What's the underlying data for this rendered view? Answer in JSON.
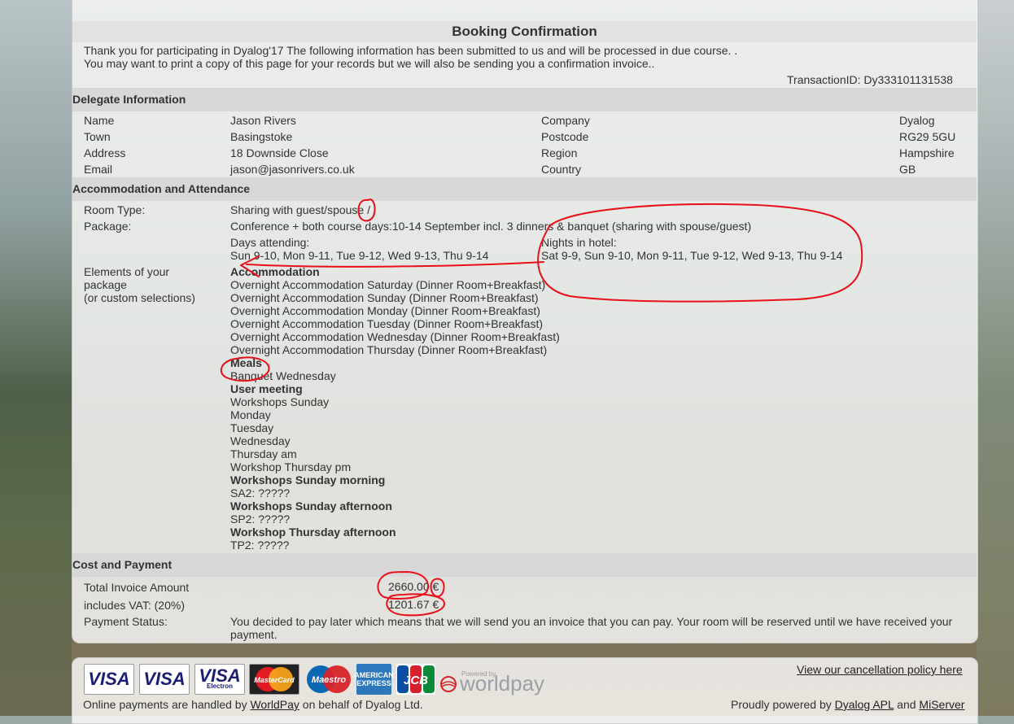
{
  "page": {
    "title": "Booking Confirmation",
    "intro_line1": "Thank you for participating in Dyalog'17 The following information has been submitted to us and will be processed in due course. .",
    "intro_line2": "You may want to print a copy of this page for your records but we will also be sending you a confirmation invoice..",
    "transaction_id": "TransactionID: Dy333101131538"
  },
  "delegate": {
    "header": "Delegate Information",
    "name_label": "Name",
    "name_value": "Jason Rivers",
    "company_label": "Company",
    "company_value": "Dyalog",
    "town_label": "Town",
    "town_value": "Basingstoke",
    "postcode_label": "Postcode",
    "postcode_value": "RG29 5GU",
    "address_label": "Address",
    "address_value": "18 Downside Close",
    "region_label": "Region",
    "region_value": "Hampshire",
    "email_label": "Email",
    "email_value": "jason@jasonrivers.co.uk",
    "country_label": "Country",
    "country_value": "GB"
  },
  "accommodation": {
    "header": "Accommodation and Attendance",
    "room_type_label": "Room Type:",
    "room_type_value": "Sharing with guest/spouse /",
    "package_label": "Package:",
    "package_value": "Conference + both course days:10-14 September incl. 3 dinners & banquet (sharing with spouse/guest)",
    "days_attending_label": "Days attending:",
    "days_attending_value": "Sun 9-10, Mon 9-11, Tue 9-12, Wed 9-13, Thu 9-14",
    "nights_label": "Nights in hotel:",
    "nights_value": "Sat 9-9, Sun 9-10, Mon 9-11, Tue 9-12, Wed 9-13, Thu 9-14",
    "elements_label_1": "Elements of your",
    "elements_label_2": "package",
    "elements_label_3": "(or custom selections)",
    "elements": [
      {
        "text": "Accommodation",
        "bold": true
      },
      {
        "text": "Overnight Accommodation Saturday (Dinner Room+Breakfast)",
        "bold": false
      },
      {
        "text": "Overnight Accommodation Sunday (Dinner Room+Breakfast)",
        "bold": false
      },
      {
        "text": "Overnight Accommodation Monday (Dinner Room+Breakfast)",
        "bold": false
      },
      {
        "text": "Overnight Accommodation Tuesday (Dinner Room+Breakfast)",
        "bold": false
      },
      {
        "text": "Overnight Accommodation Wednesday (Dinner Room+Breakfast)",
        "bold": false
      },
      {
        "text": "Overnight Accommodation Thursday (Dinner Room+Breakfast)",
        "bold": false
      },
      {
        "text": "Meals",
        "bold": true
      },
      {
        "text": "Banquet Wednesday",
        "bold": false
      },
      {
        "text": "User meeting",
        "bold": true
      },
      {
        "text": "Workshops Sunday",
        "bold": false
      },
      {
        "text": "Monday",
        "bold": false
      },
      {
        "text": "Tuesday",
        "bold": false
      },
      {
        "text": "Wednesday",
        "bold": false
      },
      {
        "text": "Thursday am",
        "bold": false
      },
      {
        "text": "Workshop Thursday pm",
        "bold": false
      },
      {
        "text": "Workshops Sunday morning",
        "bold": true
      },
      {
        "text": "SA2: ?????",
        "bold": false
      },
      {
        "text": "Workshops Sunday afternoon",
        "bold": true
      },
      {
        "text": "SP2: ?????",
        "bold": false
      },
      {
        "text": "Workshop Thursday afternoon",
        "bold": true
      },
      {
        "text": "TP2: ?????",
        "bold": false
      }
    ]
  },
  "cost": {
    "header": "Cost and Payment",
    "total_label": "Total Invoice Amount",
    "total_value": "2660.00 €",
    "vat_label": "includes VAT: (20%)",
    "vat_value": "1201.67 €",
    "status_label": "Payment Status:",
    "status_line1": "You decided to pay later which means that we will send you an invoice that you can pay. Your room will be reserved until we have received your",
    "status_line2": "payment."
  },
  "footer": {
    "cancellation_link": "View our cancellation policy here",
    "handled_prefix": "Online payments are handled by ",
    "worldpay_link": "WorldPay",
    "handled_suffix": " on behalf of Dyalog Ltd.",
    "powered_prefix": "Proudly powered by ",
    "dyalog_link": "Dyalog APL",
    "and_text": " and ",
    "miserver_link": "MiServer",
    "card_visa": "VISA",
    "card_visa_electron_sub": "Electron",
    "card_mastercard": "MasterCard",
    "card_maestro": "Maestro",
    "card_amex_1": "AMERICAN",
    "card_amex_2": "EXPRESS",
    "card_jcb": "JCB",
    "worldpay_powered": "Powered by",
    "worldpay_logo": "worldpay"
  },
  "colors": {
    "annotation_red": "#e8101a",
    "visa_blue": "#1a1f71",
    "amex_blue": "#2e77bc"
  }
}
